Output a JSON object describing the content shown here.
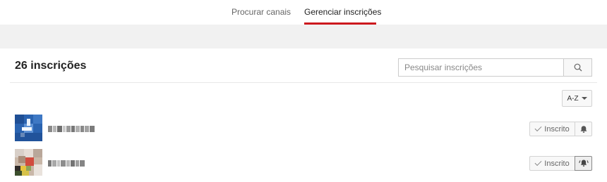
{
  "tabs": [
    {
      "label": "Procurar canais"
    },
    {
      "label": "Gerenciar inscrições"
    }
  ],
  "page": {
    "title": "26 inscrições"
  },
  "search": {
    "placeholder": "Pesquisar inscrições",
    "value": ""
  },
  "sort": {
    "label": "A-Z"
  },
  "subscriptions": [
    {
      "button_label": "Inscrito",
      "notifications": "off"
    },
    {
      "button_label": "Inscrito",
      "notifications": "all"
    }
  ],
  "colors": {
    "accent": "#cc181e",
    "band": "#f1f1f1"
  },
  "icons": [
    "search-icon",
    "caret-down-icon",
    "check-icon",
    "bell-icon",
    "bell-ringing-icon"
  ]
}
